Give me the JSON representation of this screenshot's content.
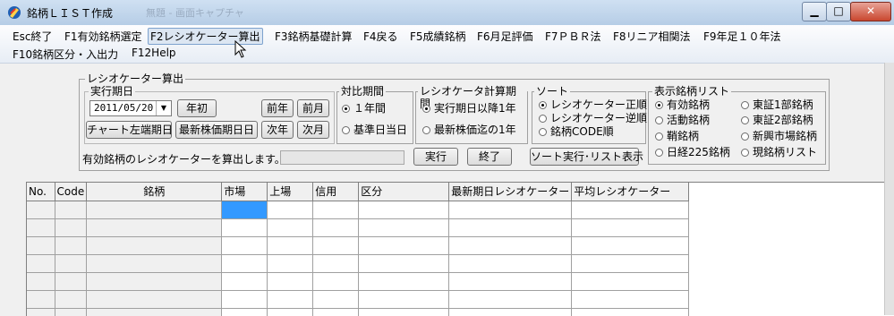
{
  "window": {
    "title": "銘柄ＬＩＳＴ作成",
    "background_window_title": "無題 - 画面キャプチャ"
  },
  "menu": [
    {
      "label": "Esc終了"
    },
    {
      "label": "F1有効銘柄選定"
    },
    {
      "label": "F2レシオケーター算出",
      "selected": true
    },
    {
      "label": "F3銘柄基礎計算"
    },
    {
      "label": "F4戻る"
    },
    {
      "label": "F5成績銘柄"
    },
    {
      "label": "F6月足評価"
    },
    {
      "label": "F7ＰＢＲ法"
    },
    {
      "label": "F8リニア相関法"
    },
    {
      "label": "F9年足１０年法"
    },
    {
      "label": "F10銘柄区分・入出力"
    },
    {
      "label": "F12Help"
    }
  ],
  "panel": {
    "title": "レシオケーター算出",
    "exec_period": {
      "title": "実行期日",
      "date": "2011/05/20",
      "year_start": "年初",
      "prev_year": "前年",
      "prev_month": "前月",
      "chart_left": "チャート左端期日",
      "latest_price": "最新株価期日日",
      "next_year": "次年",
      "next_month": "次月"
    },
    "compare_period": {
      "title": "対比期間",
      "options": [
        "１年間",
        "基準日当日"
      ],
      "selected": 0
    },
    "calc_period": {
      "title": "レシオケータ計算期間",
      "options": [
        "実行期日以降1年",
        "最新株価迄の1年"
      ],
      "selected": 0
    },
    "sort": {
      "title": "ソート",
      "options": [
        "レシオケーター正順",
        "レシオケーター逆順",
        "銘柄CODE順"
      ],
      "selected": 0
    },
    "display_list": {
      "title": "表示銘柄リスト",
      "options": [
        "有効銘柄",
        "活動銘柄",
        "鞘銘柄",
        "日経225銘柄",
        "東証1部銘柄",
        "東証2部銘柄",
        "新興市場銘柄",
        "現銘柄リスト"
      ],
      "selected": 0
    },
    "status_text": "有効銘柄のレシオケーターを算出します。",
    "progress": 0,
    "run_button": "実行",
    "end_button": "終了",
    "sort_list_button": "ソート実行･リスト表示"
  },
  "grid": {
    "headers": [
      "No.",
      "Code",
      "銘柄",
      "市場",
      "上場",
      "信用",
      "区分",
      "最新期日レシオケーター",
      "平均レシオケーター"
    ],
    "rows": [
      [
        "",
        "",
        "",
        "",
        "",
        "",
        "",
        "",
        ""
      ],
      [
        "",
        "",
        "",
        "",
        "",
        "",
        "",
        "",
        ""
      ],
      [
        "",
        "",
        "",
        "",
        "",
        "",
        "",
        "",
        ""
      ],
      [
        "",
        "",
        "",
        "",
        "",
        "",
        "",
        "",
        ""
      ],
      [
        "",
        "",
        "",
        "",
        "",
        "",
        "",
        "",
        ""
      ],
      [
        "",
        "",
        "",
        "",
        "",
        "",
        "",
        "",
        ""
      ],
      [
        "",
        "",
        "",
        "",
        "",
        "",
        "",
        "",
        ""
      ]
    ],
    "selected_cell": [
      0,
      3
    ]
  },
  "colors": {
    "selection": "#3399ff",
    "title_bar": "#b6cde6",
    "close_button": "#c9472f"
  }
}
